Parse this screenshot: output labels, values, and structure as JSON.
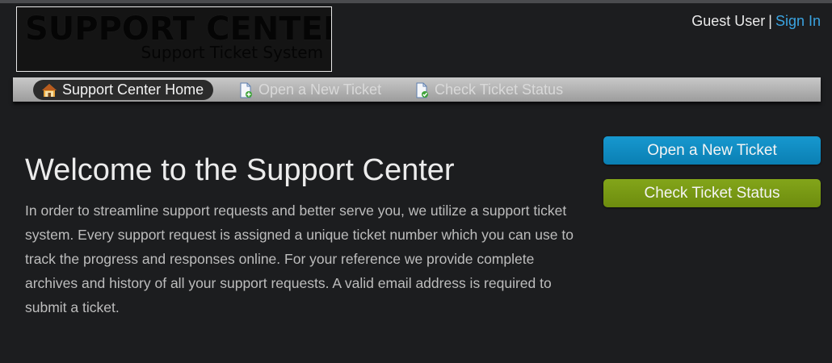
{
  "logo": {
    "title": "SUPPORT CENTER",
    "subtitle": "Support Ticket System"
  },
  "userbar": {
    "user_label": "Guest User",
    "separator": "|",
    "signin_label": "Sign In",
    "link_color": "#3aa3e0"
  },
  "nav": {
    "items": [
      {
        "label": "Support Center Home",
        "icon": "home-icon",
        "active": true
      },
      {
        "label": "Open a New Ticket",
        "icon": "new-ticket-icon",
        "active": false
      },
      {
        "label": "Check Ticket Status",
        "icon": "ticket-status-icon",
        "active": false
      }
    ]
  },
  "main": {
    "title": "Welcome to the Support Center",
    "body": "In order to streamline support requests and better serve you, we utilize a support ticket system. Every support request is assigned a unique ticket number which you can use to track the progress and responses online. For your reference we provide complete archives and history of all your support requests. A valid email address is required to submit a ticket."
  },
  "sidebar": {
    "open_ticket_label": "Open a New Ticket",
    "check_status_label": "Check Ticket Status",
    "open_color": "#1390c6",
    "check_color": "#789a12"
  }
}
